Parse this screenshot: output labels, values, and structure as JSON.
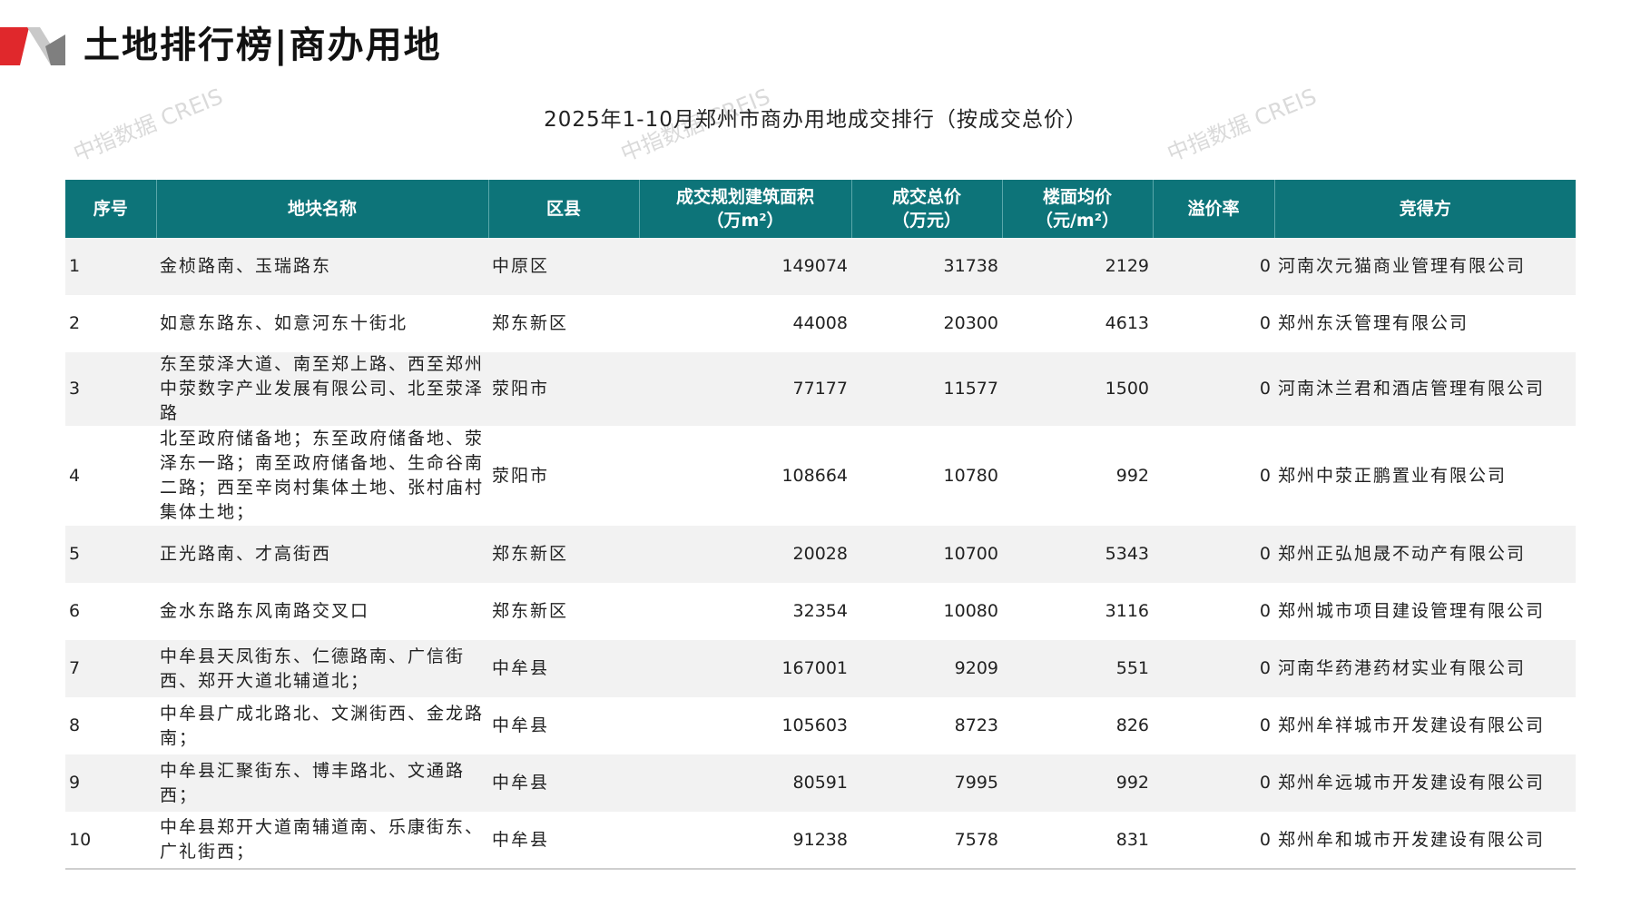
{
  "page": {
    "title": "土地排行榜|商办用地",
    "watermark": "中指数据 CREIS",
    "colors": {
      "header_bg": "#0d7479",
      "accent_red": "#c8161d",
      "deco_red": "#e0282c",
      "deco_gray": "#888888"
    }
  },
  "table": {
    "title": "2025年1-10月郑州市商办用地成交排行（按成交总价）",
    "headers": [
      {
        "line1": "序号",
        "line2": ""
      },
      {
        "line1": "地块名称",
        "line2": ""
      },
      {
        "line1": "区县",
        "line2": ""
      },
      {
        "line1": "成交规划建筑面积",
        "line2": "（万m²）"
      },
      {
        "line1": "成交总价",
        "line2": "（万元）"
      },
      {
        "line1": "楼面均价",
        "line2": "（元/m²）"
      },
      {
        "line1": "溢价率",
        "line2": ""
      },
      {
        "line1": "竞得方",
        "line2": ""
      }
    ],
    "rows": [
      {
        "idx": "1",
        "name": "金桢路南、玉瑞路东",
        "district": "中原区",
        "area": "149074",
        "total": "31738",
        "unit_price": "2129",
        "premium": "0",
        "winner": "河南次元猫商业管理有限公司"
      },
      {
        "idx": "2",
        "name": "如意东路东、如意河东十街北",
        "district": "郑东新区",
        "area": "44008",
        "total": "20300",
        "unit_price": "4613",
        "premium": "0",
        "winner": "郑州东沃管理有限公司"
      },
      {
        "idx": "3",
        "name": "东至荥泽大道、南至郑上路、西至郑州中荥数字产业发展有限公司、北至荥泽路",
        "district": "荥阳市",
        "area": "77177",
        "total": "11577",
        "unit_price": "1500",
        "premium": "0",
        "winner": "河南沐兰君和酒店管理有限公司"
      },
      {
        "idx": "4",
        "name": "北至政府储备地；东至政府储备地、荥泽东一路；南至政府储备地、生命谷南二路；西至辛岗村集体土地、张村庙村集体土地；",
        "district": "荥阳市",
        "area": "108664",
        "total": "10780",
        "unit_price": "992",
        "premium": "0",
        "winner": "郑州中荥正鹏置业有限公司"
      },
      {
        "idx": "5",
        "name": "正光路南、才高街西",
        "district": "郑东新区",
        "area": "20028",
        "total": "10700",
        "unit_price": "5343",
        "premium": "0",
        "winner": "郑州正弘旭晟不动产有限公司"
      },
      {
        "idx": "6",
        "name": "金水东路东风南路交叉口",
        "district": "郑东新区",
        "area": "32354",
        "total": "10080",
        "unit_price": "3116",
        "premium": "0",
        "winner": "郑州城市项目建设管理有限公司"
      },
      {
        "idx": "7",
        "name": "中牟县天凤街东、仁德路南、广信街西、郑开大道北辅道北；",
        "district": "中牟县",
        "area": "167001",
        "total": "9209",
        "unit_price": "551",
        "premium": "0",
        "winner": "河南华药港药材实业有限公司"
      },
      {
        "idx": "8",
        "name": "中牟县广成北路北、文渊街西、金龙路南；",
        "district": "中牟县",
        "area": "105603",
        "total": "8723",
        "unit_price": "826",
        "premium": "0",
        "winner": "郑州牟祥城市开发建设有限公司"
      },
      {
        "idx": "9",
        "name": "中牟县汇聚街东、博丰路北、文通路西；",
        "district": "中牟县",
        "area": "80591",
        "total": "7995",
        "unit_price": "992",
        "premium": "0",
        "winner": "郑州牟远城市开发建设有限公司"
      },
      {
        "idx": "10",
        "name": "中牟县郑开大道南辅道南、乐康街东、广礼街西；",
        "district": "中牟县",
        "area": "91238",
        "total": "7578",
        "unit_price": "831",
        "premium": "0",
        "winner": "郑州牟和城市开发建设有限公司"
      }
    ]
  }
}
